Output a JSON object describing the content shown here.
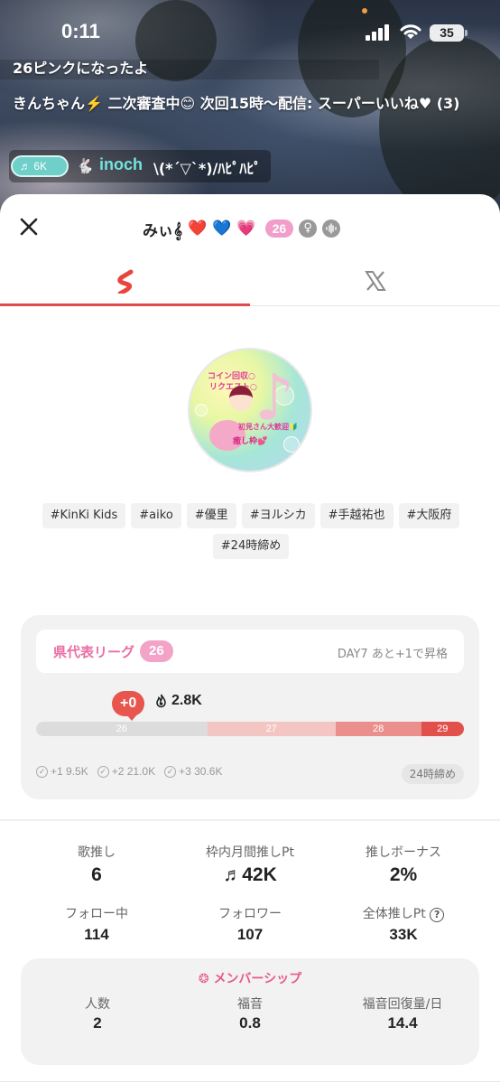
{
  "status_bar": {
    "time": "0:11",
    "battery": "35"
  },
  "stream": {
    "comment_1": "26ピンクになったよ",
    "comment_2": "きんちゃん⚡️ 二次審査中😊 次回15時〜配信: スーパーいいね♥ (3)",
    "comment_3_badge": "6K",
    "comment_3_name": "inoch",
    "comment_3_text": "\\(*´▽`*)/ﾊﾋﾟﾊﾋﾟ"
  },
  "sheet": {
    "title_name": "みぃ𝄞",
    "hearts": [
      "❤️",
      "💙",
      "💗"
    ],
    "level": "26"
  },
  "tabs": [
    {
      "name": "s",
      "icon": "app-s-logo-icon",
      "active": true
    },
    {
      "name": "x",
      "icon": "x-logo-icon",
      "active": false
    }
  ],
  "avatar": {
    "text_1": "コイン回収○",
    "text_2": "リクエスト○",
    "text_3": "初見さん大歓迎🔰",
    "text_4": "癒し枠💕"
  },
  "tags": [
    "#KinKi Kids",
    "#aiko",
    "#優里",
    "#ヨルシカ",
    "#手越祐也",
    "#大阪府",
    "#24時締め"
  ],
  "league": {
    "name": "県代表リーグ",
    "level": "26",
    "day_info": "DAY7 あと+1で昇格",
    "plus": "+0",
    "points": "2.8K",
    "segments": [
      {
        "label": "26",
        "color": "#dcdcdc",
        "fraction": 0.4
      },
      {
        "label": "27",
        "color": "#f3c6c4",
        "fraction": 0.3
      },
      {
        "label": "28",
        "color": "#ea8f8c",
        "fraction": 0.2
      },
      {
        "label": "29",
        "color": "#e2504c",
        "fraction": 0.1
      }
    ],
    "milestones": [
      "+1 9.5K",
      "+2 21.0K",
      "+3 30.6K"
    ],
    "deadline": "24時締め"
  },
  "stats": {
    "songs_label": "歌推し",
    "songs_value": "6",
    "monthly_label": "枠内月間推しPt",
    "monthly_value": "42K",
    "bonus_label": "推しボーナス",
    "bonus_value": "2%",
    "following_label": "フォロー中",
    "following_value": "114",
    "followers_label": "フォロワー",
    "followers_value": "107",
    "total_label": "全体推しPt",
    "total_value": "33K"
  },
  "membership": {
    "title": "メンバーシップ",
    "members_label": "人数",
    "members_value": "2",
    "fukuon_label": "福音",
    "fukuon_value": "0.8",
    "recovery_label": "福音回復量/日",
    "recovery_value": "14.4"
  }
}
